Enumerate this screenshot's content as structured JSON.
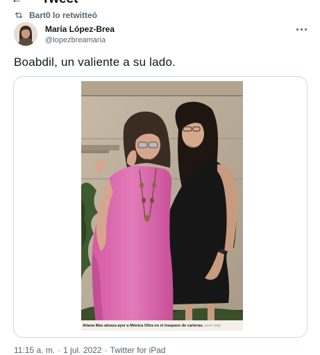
{
  "header": {
    "back_icon": "arrow-left-icon",
    "title": "Tweet"
  },
  "retweet": {
    "icon": "retweet-icon",
    "text": "Bart0 lo retwitteó"
  },
  "author": {
    "name": "María López-Brea",
    "handle": "@lopezbreamaria"
  },
  "more_icon": "more-horizontal-icon",
  "tweet": {
    "text": "Boabdil, un valiente a su lado."
  },
  "media": {
    "caption": "Aitana Mas abraza ayer a Mónica Oltra en el traspaso de carteras.",
    "credit": "KAI F. / EFE"
  },
  "footer": {
    "time": "11:15 a. m.",
    "date": "1 jul. 2022",
    "source": "Twitter for iPad"
  },
  "colors": {
    "text": "#0f1419",
    "secondary": "#536471",
    "border": "#cfd9de"
  }
}
